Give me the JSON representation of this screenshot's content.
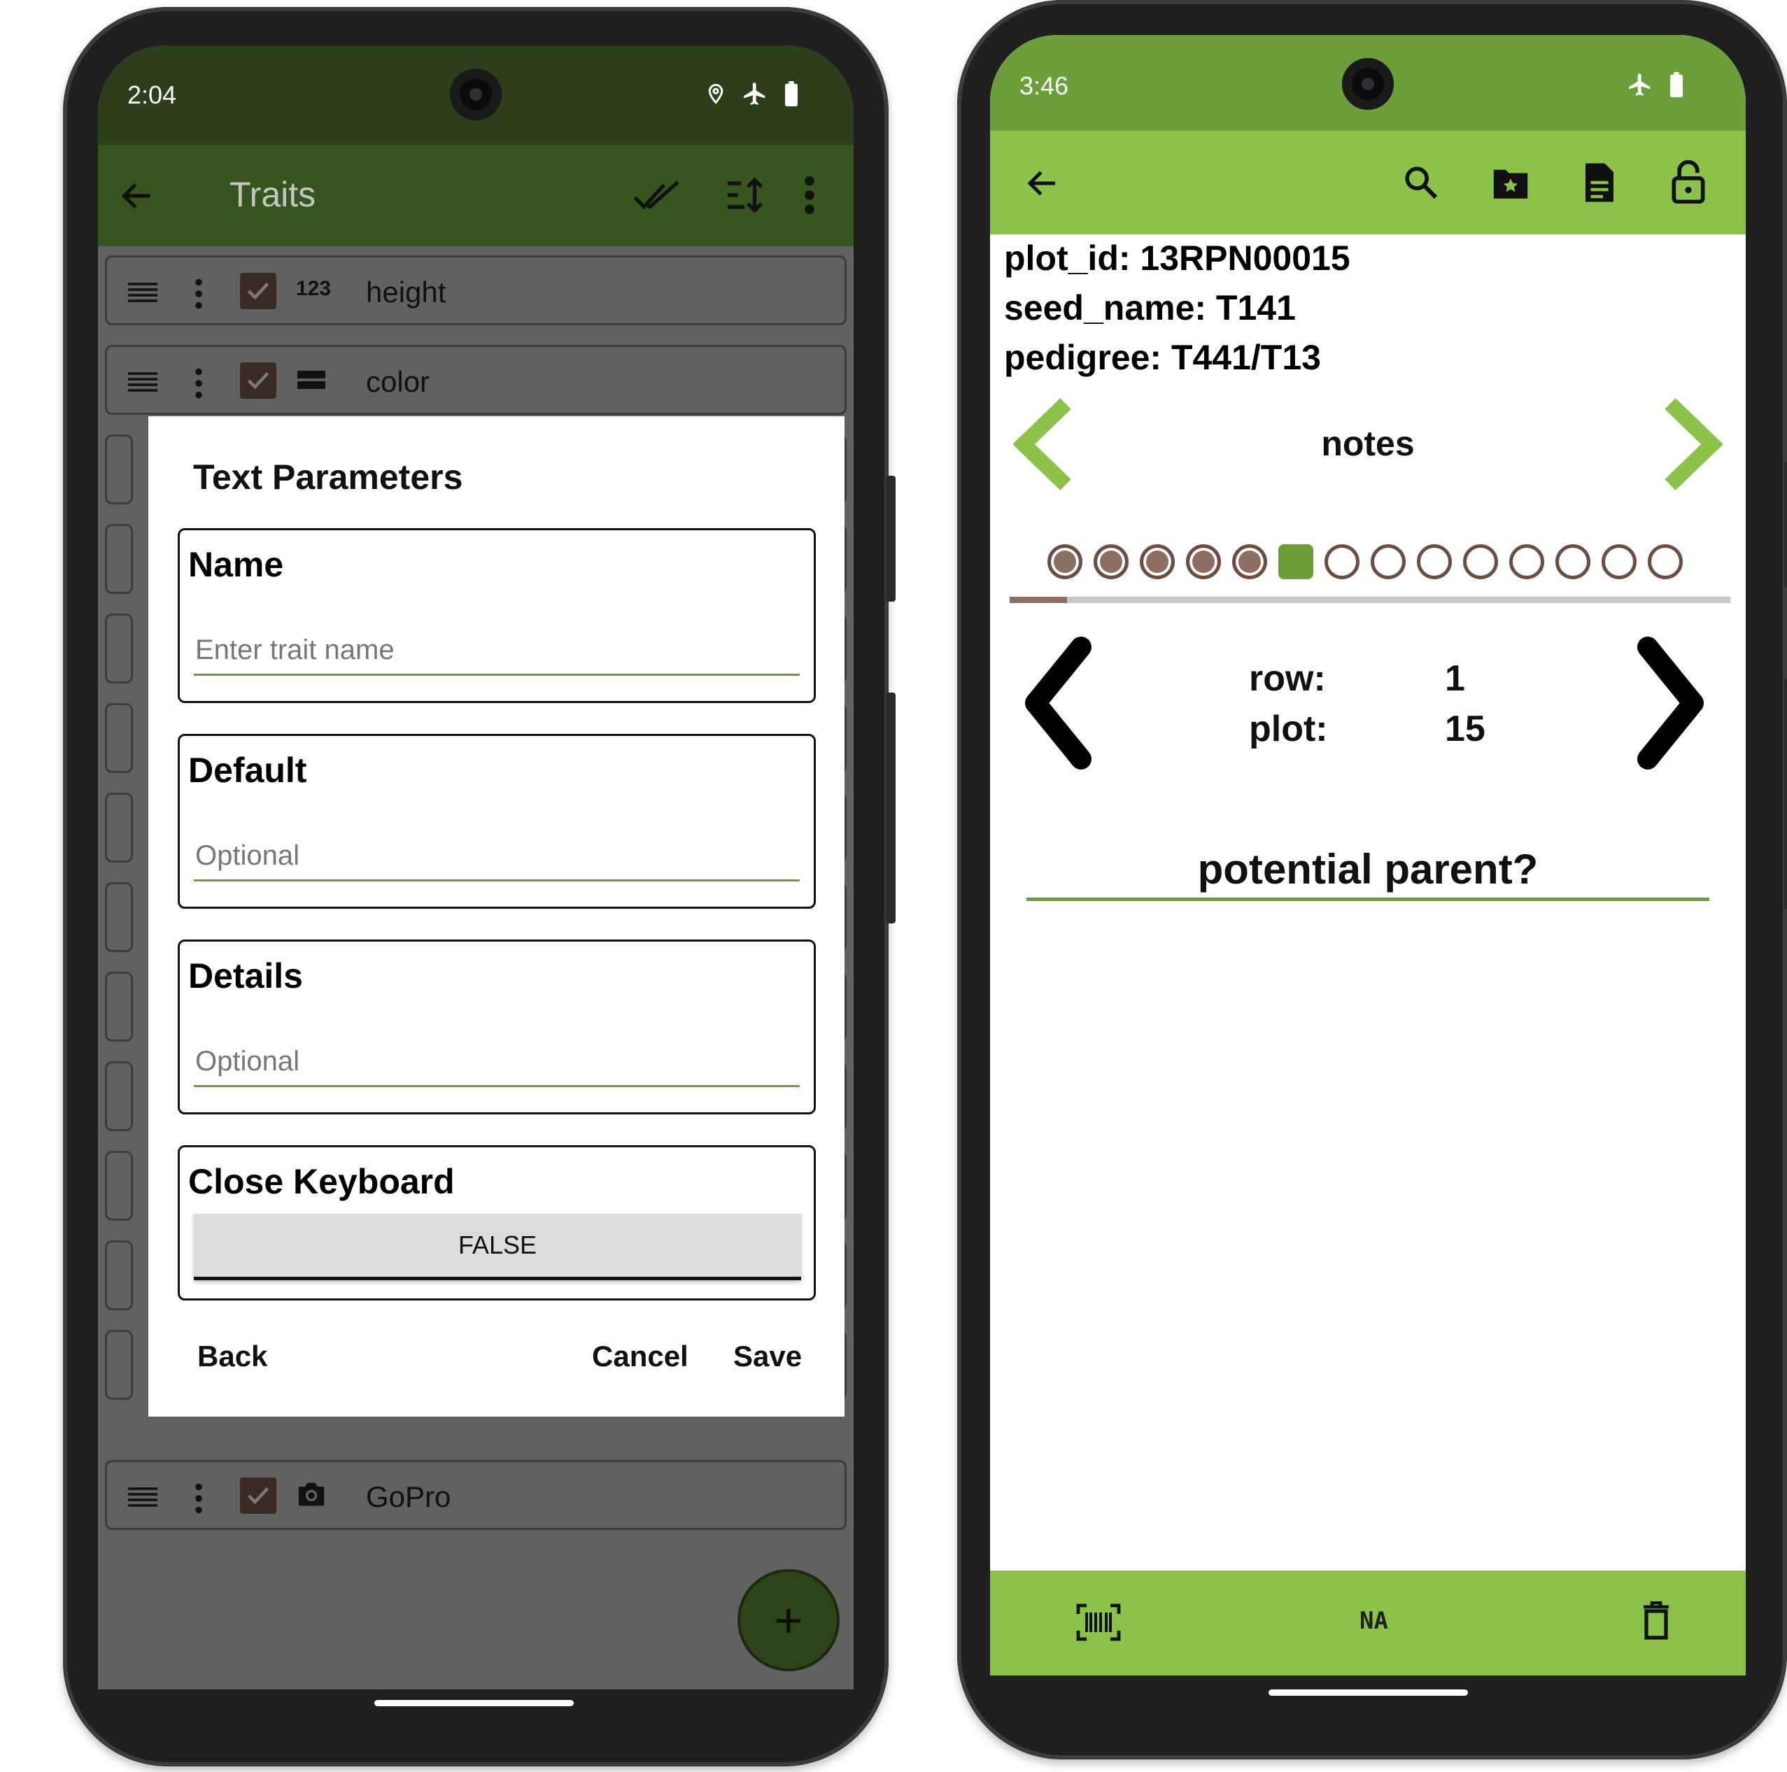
{
  "left_phone": {
    "status": {
      "time": "2:04"
    },
    "toolbar": {
      "title": "Traits"
    },
    "traits": [
      {
        "type_label": "123",
        "name": "height"
      },
      {
        "type_label": "",
        "name": "color"
      },
      {
        "type_label": "",
        "name": "GoPro"
      }
    ],
    "dialog": {
      "title": "Text Parameters",
      "name_label": "Name",
      "name_placeholder": "Enter trait name",
      "default_label": "Default",
      "default_placeholder": "Optional",
      "details_label": "Details",
      "details_placeholder": "Optional",
      "close_keyboard_label": "Close Keyboard",
      "close_keyboard_value": "FALSE",
      "back_label": "Back",
      "cancel_label": "Cancel",
      "save_label": "Save"
    },
    "fab_label": "+"
  },
  "right_phone": {
    "status": {
      "time": "3:46"
    },
    "info": [
      "plot_id: 13RPN00015",
      "seed_name: T141",
      "pedigree: T441/T13"
    ],
    "trait_name": "notes",
    "progress": {
      "completed": 5,
      "current_index": 5,
      "total": 14,
      "fraction": 0.08
    },
    "row_label": "row:",
    "row_value": "1",
    "plot_label": "plot:",
    "plot_value": "15",
    "notes_value": "potential parent?",
    "bottom_bar": {
      "na_label": "NA"
    }
  },
  "colors": {
    "left_toolbar": "#37551f",
    "right_toolbar": "#8bc34a",
    "accent_green": "#6a9f3a",
    "brown": "#8d6e63"
  }
}
